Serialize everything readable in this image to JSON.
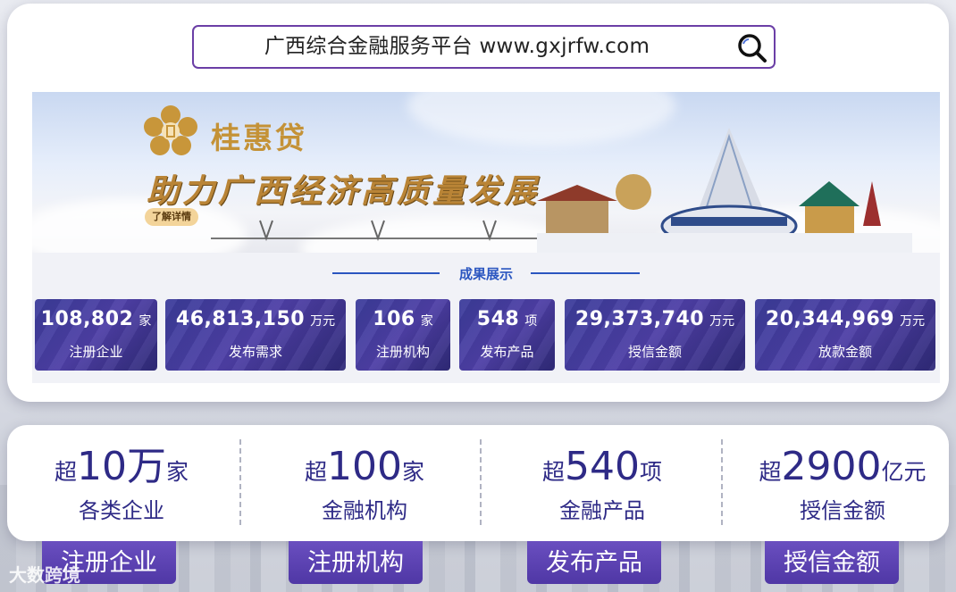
{
  "search": {
    "text": "广西综合金融服务平台  www.gxjrfw.com"
  },
  "banner": {
    "brand": "桂惠贷",
    "slogan": "助力广西经济高质量发展",
    "detail_button": "了解详情"
  },
  "showcase": {
    "title": "成果展示",
    "tiles": [
      {
        "value": "108,802",
        "unit": "家",
        "label": "注册企业"
      },
      {
        "value": "46,813,150",
        "unit": "万元",
        "label": "发布需求"
      },
      {
        "value": "106",
        "unit": "家",
        "label": "注册机构"
      },
      {
        "value": "548",
        "unit": "项",
        "label": "发布产品"
      },
      {
        "value": "29,373,740",
        "unit": "万元",
        "label": "授信金额"
      },
      {
        "value": "20,344,969",
        "unit": "万元",
        "label": "放款金额"
      }
    ]
  },
  "stats": [
    {
      "prefix": "超",
      "number": "10万",
      "unit": "家",
      "desc": "各类企业"
    },
    {
      "prefix": "超",
      "number": "100",
      "unit": "家",
      "desc": "金融机构"
    },
    {
      "prefix": "超",
      "number": "540",
      "unit": "项",
      "desc": "金融产品"
    },
    {
      "prefix": "超",
      "number": "2900",
      "unit": "亿元",
      "desc": "授信金额"
    }
  ],
  "bottom_tabs": [
    "注册企业",
    "注册机构",
    "发布产品",
    "授信金额"
  ],
  "watermark": "大数跨境",
  "colors": {
    "accent": "#6b3fa6",
    "stat_text": "#2e2a86",
    "section_title": "#2b56c0",
    "brand_gold": "#c49237"
  }
}
